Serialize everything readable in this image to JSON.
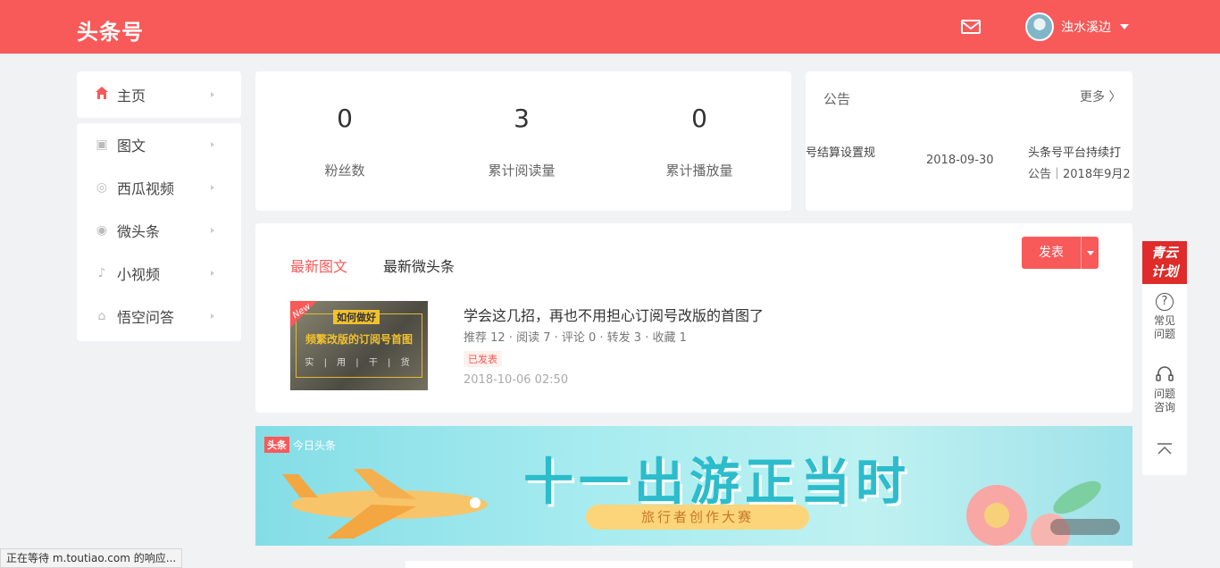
{
  "header": {
    "logo": "头条号",
    "username": "浊水溪边",
    "mail_icon": "mail-icon"
  },
  "sidebar": {
    "home": {
      "label": "主页",
      "icon": "home-icon"
    },
    "items": [
      {
        "label": "图文",
        "icon": "image-text-icon"
      },
      {
        "label": "西瓜视频",
        "icon": "video-icon"
      },
      {
        "label": "微头条",
        "icon": "micro-post-icon"
      },
      {
        "label": "小视频",
        "icon": "short-video-icon"
      },
      {
        "label": "悟空问答",
        "icon": "qa-icon"
      }
    ]
  },
  "stats": [
    {
      "value": "0",
      "label": "粉丝数"
    },
    {
      "value": "3",
      "label": "累计阅读量"
    },
    {
      "value": "0",
      "label": "累计播放量"
    }
  ],
  "notice": {
    "title": "公告",
    "more": "更多",
    "item1_title": "号结算设置规",
    "item1_date": "2018-09-30",
    "item2_title": "头条号平台持续打",
    "item2_meta": "公告｜2018年9月2"
  },
  "articles": {
    "tabs": [
      "最新图文",
      "最新微头条"
    ],
    "publish_label": "发表",
    "item": {
      "badge": "New",
      "thumb_tag": "如何做好",
      "thumb_title": "频繁改版的订阅号首图",
      "thumb_sub": "实 | 用 | 干 | 货",
      "title": "学会这几招，再也不用担心订阅号改版的首图了",
      "meta": "推荐 12  ·  阅读 7  ·  评论 0  ·  转发 3  ·  收藏 1",
      "status": "已发表",
      "date": "2018-10-06 02:50"
    }
  },
  "banner": {
    "tag_box": "头条",
    "tag_text": "今日头条",
    "headline": "十一出游正当时",
    "sub": "旅行者创作大赛"
  },
  "floater": {
    "badge_line1": "青云",
    "badge_line2": "计划",
    "faq": "常见问题",
    "consult": "问题咨询"
  },
  "statusbar": "正在等待 m.toutiao.com 的响应..."
}
